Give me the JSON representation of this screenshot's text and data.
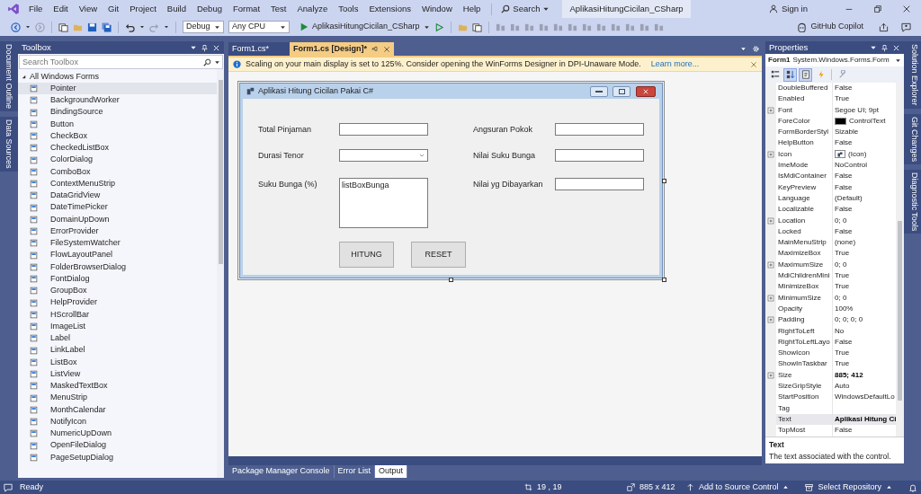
{
  "menu_bar": {
    "items": [
      "File",
      "Edit",
      "View",
      "Git",
      "Project",
      "Build",
      "Debug",
      "Format",
      "Test",
      "Analyze",
      "Tools",
      "Extensions",
      "Window",
      "Help"
    ],
    "search": "Search",
    "solution_title": "AplikasiHitungCicilan_CSharp",
    "sign_in": "Sign in"
  },
  "toolbar": {
    "configuration": "Debug",
    "platform": "Any CPU",
    "start_target": "AplikasiHitungCicilan_CSharp",
    "copilot": "GitHub Copilot"
  },
  "left_side_tabs": [
    "Document Outline",
    "Data Sources"
  ],
  "toolbox": {
    "title": "Toolbox",
    "search_placeholder": "Search Toolbox",
    "group": {
      "label": "All Windows Forms",
      "expanded": true
    },
    "items": [
      {
        "label": "Pointer",
        "selected": true
      },
      {
        "label": "BackgroundWorker",
        "selected": false
      },
      {
        "label": "BindingSource",
        "selected": false
      },
      {
        "label": "Button",
        "selected": false
      },
      {
        "label": "CheckBox",
        "selected": false
      },
      {
        "label": "CheckedListBox",
        "selected": false
      },
      {
        "label": "ColorDialog",
        "selected": false
      },
      {
        "label": "ComboBox",
        "selected": false
      },
      {
        "label": "ContextMenuStrip",
        "selected": false
      },
      {
        "label": "DataGridView",
        "selected": false
      },
      {
        "label": "DateTimePicker",
        "selected": false
      },
      {
        "label": "DomainUpDown",
        "selected": false
      },
      {
        "label": "ErrorProvider",
        "selected": false
      },
      {
        "label": "FileSystemWatcher",
        "selected": false
      },
      {
        "label": "FlowLayoutPanel",
        "selected": false
      },
      {
        "label": "FolderBrowserDialog",
        "selected": false
      },
      {
        "label": "FontDialog",
        "selected": false
      },
      {
        "label": "GroupBox",
        "selected": false
      },
      {
        "label": "HelpProvider",
        "selected": false
      },
      {
        "label": "HScrollBar",
        "selected": false
      },
      {
        "label": "ImageList",
        "selected": false
      },
      {
        "label": "Label",
        "selected": false
      },
      {
        "label": "LinkLabel",
        "selected": false
      },
      {
        "label": "ListBox",
        "selected": false
      },
      {
        "label": "ListView",
        "selected": false
      },
      {
        "label": "MaskedTextBox",
        "selected": false
      },
      {
        "label": "MenuStrip",
        "selected": false
      },
      {
        "label": "MonthCalendar",
        "selected": false
      },
      {
        "label": "NotifyIcon",
        "selected": false
      },
      {
        "label": "NumericUpDown",
        "selected": false
      },
      {
        "label": "OpenFileDialog",
        "selected": false
      },
      {
        "label": "PageSetupDialog",
        "selected": false
      }
    ]
  },
  "editor": {
    "tabs": [
      {
        "label": "Form1.cs*",
        "selected": false
      },
      {
        "label": "Form1.cs [Design]*",
        "selected": true
      }
    ],
    "info_bar": {
      "message": "Scaling on your main display is set to 125%. Consider opening the WinForms Designer in DPI-Unaware Mode.",
      "link": "Learn more..."
    },
    "form": {
      "title": "Aplikasi Hitung Cicilan Pakai C#",
      "left_fields": [
        {
          "label": "Total Pinjaman",
          "kind": "textbox"
        },
        {
          "label": "Durasi Tenor",
          "kind": "combobox"
        },
        {
          "label": "Suku Bunga (%)",
          "kind": "listbox",
          "value": "listBoxBunga"
        }
      ],
      "right_fields": [
        {
          "label": "Angsuran Pokok",
          "kind": "textbox"
        },
        {
          "label": "Nilai Suku Bunga",
          "kind": "textbox"
        },
        {
          "label": "Nilai yg Dibayarkan",
          "kind": "textbox"
        }
      ],
      "buttons": [
        "HITUNG",
        "RESET"
      ]
    }
  },
  "bottom_panel": {
    "tabs": [
      {
        "label": "Package Manager Console",
        "selected": false
      },
      {
        "label": "Error List",
        "selected": false
      },
      {
        "label": "Output",
        "selected": true
      }
    ]
  },
  "properties": {
    "title": "Properties",
    "object": "Form1",
    "type": "System.Windows.Forms.Form",
    "view_buttons": [
      {
        "selected": false
      },
      {
        "selected": true
      },
      {
        "selected": true
      },
      {
        "selected": false
      },
      {
        "selected": false
      }
    ],
    "rows": [
      {
        "name": "DoubleBuffered",
        "value": "False",
        "expandable": false,
        "selected": false,
        "modified": false
      },
      {
        "name": "Enabled",
        "value": "True",
        "expandable": false,
        "selected": false,
        "modified": false
      },
      {
        "name": "Font",
        "value": "Segoe UI; 9pt",
        "expandable": true,
        "selected": false,
        "modified": false
      },
      {
        "name": "ForeColor",
        "value": "ControlText",
        "kind": "color",
        "color": "#000000",
        "expandable": false,
        "selected": false,
        "modified": false
      },
      {
        "name": "FormBorderStyl",
        "value": "Sizable",
        "expandable": false,
        "selected": false,
        "modified": false
      },
      {
        "name": "HelpButton",
        "value": "False",
        "expandable": false,
        "selected": false,
        "modified": false
      },
      {
        "name": "Icon",
        "value": "(Icon)",
        "kind": "icon",
        "expandable": true,
        "selected": false,
        "modified": false
      },
      {
        "name": "ImeMode",
        "value": "NoControl",
        "expandable": false,
        "selected": false,
        "modified": false
      },
      {
        "name": "IsMdiContainer",
        "value": "False",
        "expandable": false,
        "selected": false,
        "modified": false
      },
      {
        "name": "KeyPreview",
        "value": "False",
        "expandable": false,
        "selected": false,
        "modified": false
      },
      {
        "name": "Language",
        "value": "(Default)",
        "expandable": false,
        "selected": false,
        "modified": false
      },
      {
        "name": "Localizable",
        "value": "False",
        "expandable": false,
        "selected": false,
        "modified": false
      },
      {
        "name": "Location",
        "value": "0; 0",
        "expandable": true,
        "selected": false,
        "modified": false
      },
      {
        "name": "Locked",
        "value": "False",
        "expandable": false,
        "selected": false,
        "modified": false
      },
      {
        "name": "MainMenuStrip",
        "value": "(none)",
        "expandable": false,
        "selected": false,
        "modified": false
      },
      {
        "name": "MaximizeBox",
        "value": "True",
        "expandable": false,
        "selected": false,
        "modified": false
      },
      {
        "name": "MaximumSize",
        "value": "0; 0",
        "expandable": true,
        "selected": false,
        "modified": false
      },
      {
        "name": "MdiChildrenMini",
        "value": "True",
        "expandable": false,
        "selected": false,
        "modified": false
      },
      {
        "name": "MinimizeBox",
        "value": "True",
        "expandable": false,
        "selected": false,
        "modified": false
      },
      {
        "name": "MinimumSize",
        "value": "0; 0",
        "expandable": true,
        "selected": false,
        "modified": false
      },
      {
        "name": "Opacity",
        "value": "100%",
        "expandable": false,
        "selected": false,
        "modified": false
      },
      {
        "name": "Padding",
        "value": "0; 0; 0; 0",
        "expandable": true,
        "selected": false,
        "modified": false
      },
      {
        "name": "RightToLeft",
        "value": "No",
        "expandable": false,
        "selected": false,
        "modified": false
      },
      {
        "name": "RightToLeftLayo",
        "value": "False",
        "expandable": false,
        "selected": false,
        "modified": false
      },
      {
        "name": "ShowIcon",
        "value": "True",
        "expandable": false,
        "selected": false,
        "modified": false
      },
      {
        "name": "ShowInTaskbar",
        "value": "True",
        "expandable": false,
        "selected": false,
        "modified": false
      },
      {
        "name": "Size",
        "value": "885; 412",
        "expandable": true,
        "selected": false,
        "modified": true
      },
      {
        "name": "SizeGripStyle",
        "value": "Auto",
        "expandable": false,
        "selected": false,
        "modified": false
      },
      {
        "name": "StartPosition",
        "value": "WindowsDefaultLo",
        "expandable": false,
        "selected": false,
        "modified": false
      },
      {
        "name": "Tag",
        "expandable": false,
        "selected": false
      },
      {
        "name": "Text",
        "value": "Aplikasi Hitung Ci",
        "expandable": false,
        "selected": true,
        "modified": true
      },
      {
        "name": "TopMost",
        "value": "False",
        "expandable": false,
        "selected": false,
        "modified": false
      }
    ],
    "description": {
      "title": "Text",
      "text": "The text associated with the control."
    }
  },
  "right_side_tabs": [
    "Solution Explorer",
    "Git Changes",
    "Diagnostic Tools"
  ],
  "status_bar": {
    "ready": "Ready",
    "position": "19 , 19",
    "size": "885 x 412",
    "source_control": "Add to Source Control",
    "repository": "Select Repository"
  }
}
